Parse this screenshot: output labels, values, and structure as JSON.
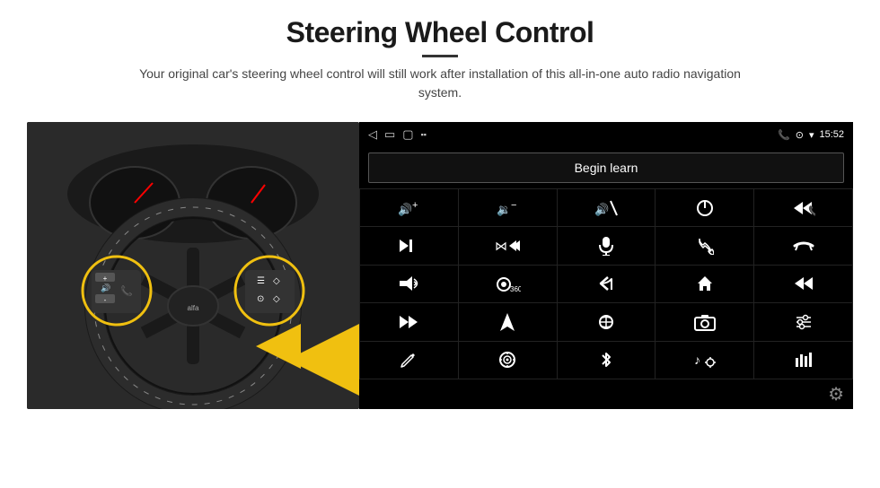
{
  "header": {
    "title": "Steering Wheel Control",
    "subtitle": "Your original car's steering wheel control will still work after installation of this all-in-one auto radio navigation system."
  },
  "status_bar": {
    "time": "15:52",
    "back_icon": "◁",
    "home_icon": "▭",
    "square_icon": "▢",
    "signal_icon": "▪▪",
    "phone_icon": "📞",
    "location_icon": "⊙",
    "wifi_icon": "▾"
  },
  "begin_learn": {
    "label": "Begin learn"
  },
  "controls": [
    {
      "icon": "🔊+",
      "label": "vol-up",
      "unicode": ""
    },
    {
      "icon": "🔉-",
      "label": "vol-down",
      "unicode": ""
    },
    {
      "icon": "🔇",
      "label": "mute",
      "unicode": ""
    },
    {
      "icon": "⏻",
      "label": "power",
      "unicode": ""
    },
    {
      "icon": "⏮",
      "label": "prev-track-phone",
      "unicode": ""
    },
    {
      "icon": "⏭|",
      "label": "next",
      "unicode": ""
    },
    {
      "icon": "⋈⏭",
      "label": "shuffle-next",
      "unicode": ""
    },
    {
      "icon": "🎙",
      "label": "mic",
      "unicode": ""
    },
    {
      "icon": "📞",
      "label": "call",
      "unicode": ""
    },
    {
      "icon": "📵",
      "label": "end-call",
      "unicode": ""
    },
    {
      "icon": "📢",
      "label": "horn",
      "unicode": ""
    },
    {
      "icon": "360",
      "label": "camera-360",
      "unicode": ""
    },
    {
      "icon": "↩",
      "label": "back",
      "unicode": ""
    },
    {
      "icon": "🏠",
      "label": "home",
      "unicode": ""
    },
    {
      "icon": "⏮⏮",
      "label": "fast-prev",
      "unicode": ""
    },
    {
      "icon": "⏭⏭",
      "label": "fast-forward",
      "unicode": ""
    },
    {
      "icon": "▶",
      "label": "nav",
      "unicode": ""
    },
    {
      "icon": "⇌",
      "label": "source",
      "unicode": ""
    },
    {
      "icon": "📷",
      "label": "camera",
      "unicode": ""
    },
    {
      "icon": "🎚",
      "label": "eq",
      "unicode": ""
    },
    {
      "icon": "✏",
      "label": "edit",
      "unicode": ""
    },
    {
      "icon": "⊙",
      "label": "target",
      "unicode": ""
    },
    {
      "icon": "✱",
      "label": "bluetooth",
      "unicode": ""
    },
    {
      "icon": "♪⚙",
      "label": "music-settings",
      "unicode": ""
    },
    {
      "icon": "📊",
      "label": "equalizer",
      "unicode": ""
    }
  ],
  "settings_icon": "⚙"
}
